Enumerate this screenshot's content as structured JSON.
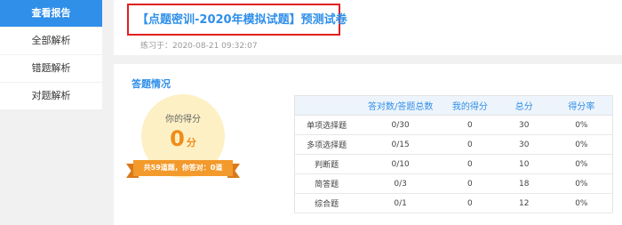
{
  "sidebar": {
    "items": [
      {
        "label": "查看报告",
        "active": true
      },
      {
        "label": "全部解析"
      },
      {
        "label": "错题解析"
      },
      {
        "label": "对题解析"
      }
    ]
  },
  "header": {
    "title": "【点题密训-2020年模拟试题】预测试卷",
    "practice_time": "练习于：2020-08-21 09:32:07"
  },
  "summary": {
    "section_title": "答题情况",
    "score_label": "你的得分",
    "score_value": "0",
    "score_unit": "分",
    "ribbon_text": "共59道题，你答对：0道"
  },
  "table": {
    "headers": [
      "",
      "答对数/答题总数",
      "我的得分",
      "总分",
      "得分率"
    ],
    "rows": [
      [
        "单项选择题",
        "0/30",
        "0",
        "30",
        "0%"
      ],
      [
        "多项选择题",
        "0/15",
        "0",
        "30",
        "0%"
      ],
      [
        "判断题",
        "0/10",
        "0",
        "10",
        "0%"
      ],
      [
        "简答题",
        "0/3",
        "0",
        "18",
        "0%"
      ],
      [
        "综合题",
        "0/1",
        "0",
        "12",
        "0%"
      ]
    ]
  },
  "colors": {
    "accent": "#2f8fe9",
    "highlight_border": "#e02020",
    "score": "#f08c1a"
  }
}
